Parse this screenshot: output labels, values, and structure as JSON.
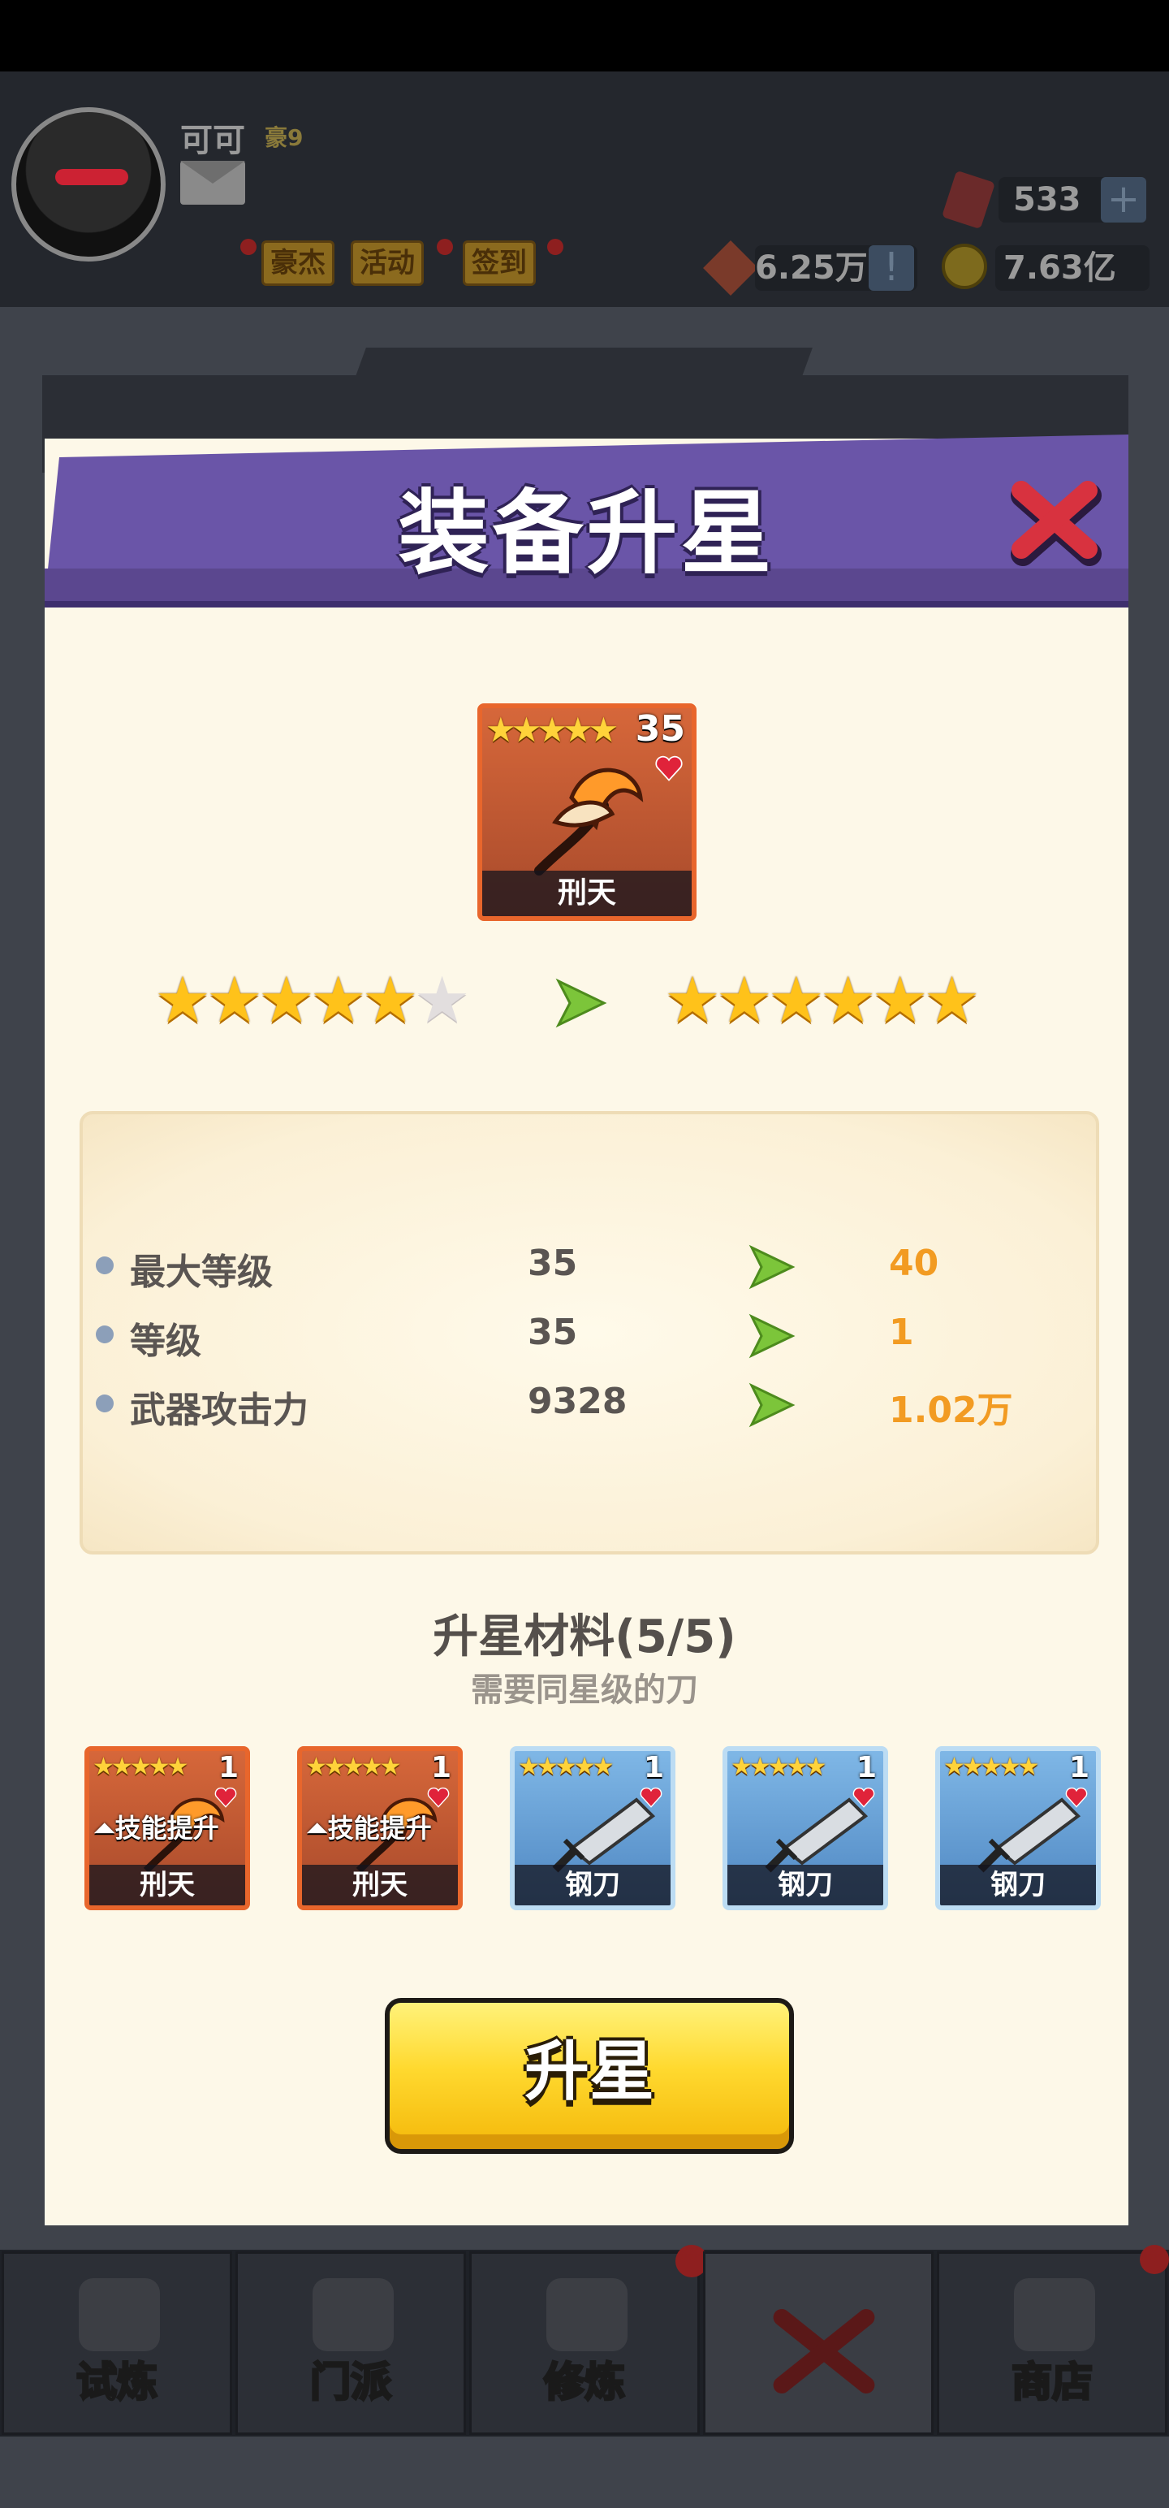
{
  "player": {
    "name": "可可",
    "vip": "豪9"
  },
  "top_buttons": [
    "豪杰",
    "活动",
    "签到"
  ],
  "resources": {
    "gems": "533",
    "tokens": "6.25万",
    "coins": "7.63亿"
  },
  "modal": {
    "title": "装备升星",
    "item": {
      "stars": "★★★★★",
      "count": "35",
      "name": "刑天"
    },
    "current_stars": 5,
    "next_stars": 6,
    "total_stars": 6,
    "stats": [
      {
        "label": "最大等级",
        "from": "35",
        "to": "40"
      },
      {
        "label": "等级",
        "from": "35",
        "to": "1"
      },
      {
        "label": "武器攻击力",
        "from": "9328",
        "to": "1.02万"
      }
    ],
    "materials_title": "升星材料(5/5)",
    "materials_sub": "需要同星级的刀",
    "materials": [
      {
        "stars": "★★★★★",
        "count": "1",
        "name": "刑天",
        "skill": "技能提升",
        "color": "orange"
      },
      {
        "stars": "★★★★★",
        "count": "1",
        "name": "刑天",
        "skill": "技能提升",
        "color": "orange"
      },
      {
        "stars": "★★★★★",
        "count": "1",
        "name": "钢刀",
        "skill": "",
        "color": "blue"
      },
      {
        "stars": "★★★★★",
        "count": "1",
        "name": "钢刀",
        "skill": "",
        "color": "blue"
      },
      {
        "stars": "★★★★★",
        "count": "1",
        "name": "钢刀",
        "skill": "",
        "color": "blue"
      }
    ],
    "upgrade_button": "升星"
  },
  "bottom_nav": [
    "试炼",
    "门派",
    "修炼",
    "",
    "商店"
  ],
  "colors": {
    "header": "#6a55a8",
    "accent_value": "#f29b22",
    "button": "#ffd92f"
  }
}
